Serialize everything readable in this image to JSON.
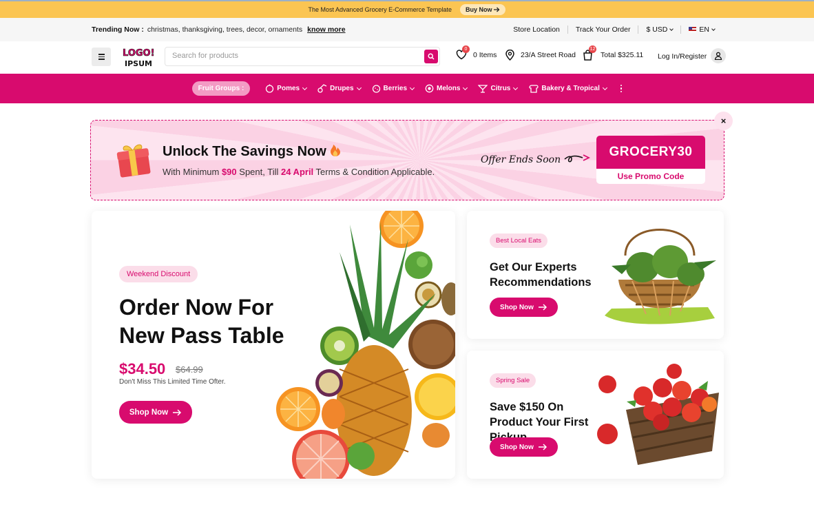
{
  "announcement": {
    "text": "The Most Advanced Grocery E-Commerce Template",
    "button": "Buy Now"
  },
  "trending": {
    "label": "Trending Now :",
    "tags": "christmas, thanksgiving, trees, decor, ornaments",
    "link": "know more",
    "store_location": "Store Location",
    "track_order": "Track Your Order",
    "currency": "$ USD",
    "language": "EN"
  },
  "header": {
    "logo_text_1": "LOGO!",
    "logo_text_2": "IPSUM",
    "search_placeholder": "Search for products",
    "wishlist_count": "0",
    "wishlist_label": "0 Items",
    "address": "23/A Street Road",
    "cart_count": "12",
    "cart_total": "Total $325.11",
    "login": "Log In/Register"
  },
  "categories": {
    "groups_label": "Fruit Groups :",
    "items": [
      {
        "label": "Pomes",
        "icon": "apple-icon"
      },
      {
        "label": "Drupes",
        "icon": "cherry-icon"
      },
      {
        "label": "Berries",
        "icon": "berry-icon"
      },
      {
        "label": "Melons",
        "icon": "melon-icon"
      },
      {
        "label": "Citrus",
        "icon": "citrus-icon"
      },
      {
        "label": "Bakery & Tropical",
        "icon": "bread-icon"
      }
    ]
  },
  "promo": {
    "title": "Unlock The Savings Now",
    "sub_prefix": "With Minimum ",
    "sub_amount": "$90",
    "sub_mid": " Spent, Till ",
    "sub_date": "24 April",
    "sub_suffix": " Terms & Condition Applicable.",
    "offer": "Offer Ends Soon",
    "code": "GROCERY30",
    "code_cta": "Use Promo Code",
    "close": "×"
  },
  "hero": {
    "pill": "Weekend Discount",
    "title": "Order Now For New Pass Table",
    "price": "$34.50",
    "old_price": "$64.99",
    "note": "Don't Miss This Limited Time Ofter.",
    "cta": "Shop Now"
  },
  "side_cards": [
    {
      "pill": "Best Local Eats",
      "title": "Get Our Experts Recommendations",
      "cta": "Shop Now"
    },
    {
      "pill": "Spring Sale",
      "title": "Save $150 On Product Your First Pickup",
      "cta": "Shop Now"
    }
  ],
  "colors": {
    "brand": "#d80b6e",
    "announce_bg": "#fbc552",
    "pill_bg": "#fbdde9"
  }
}
